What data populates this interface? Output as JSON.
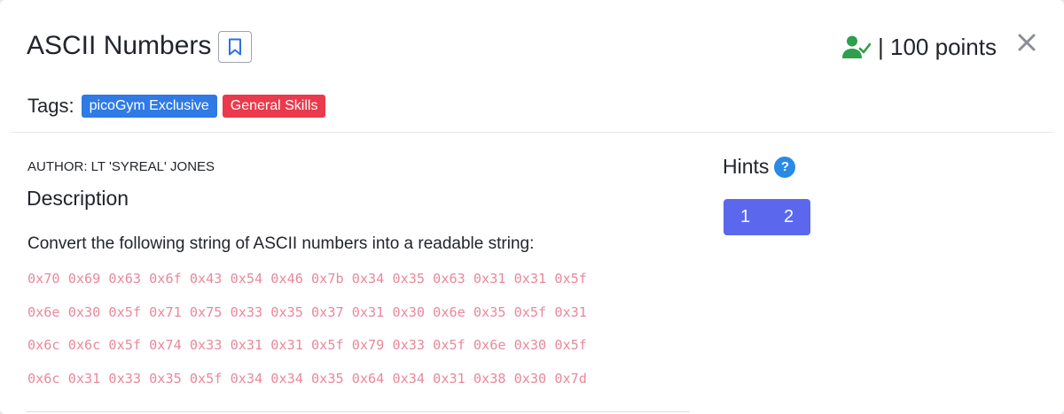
{
  "challenge": {
    "title": "ASCII Numbers",
    "points_text": "| 100 points",
    "tags_label": "Tags:",
    "tags": [
      "picoGym Exclusive",
      "General Skills"
    ],
    "author": "AUTHOR: LT 'SYREAL' JONES",
    "description_heading": "Description",
    "description_text": "Convert the following string of ASCII numbers into a readable string:",
    "code_lines": [
      "0x70 0x69 0x63 0x6f 0x43 0x54 0x46 0x7b 0x34 0x35 0x63 0x31 0x31 0x5f",
      "0x6e 0x30 0x5f 0x71 0x75 0x33 0x35 0x37 0x31 0x30 0x6e 0x35 0x5f 0x31",
      "0x6c 0x6c 0x5f 0x74 0x33 0x31 0x31 0x5f 0x79 0x33 0x5f 0x6e 0x30 0x5f",
      "0x6c 0x31 0x33 0x35 0x5f 0x34 0x34 0x35 0x64 0x34 0x31 0x38 0x30 0x7d"
    ]
  },
  "hints": {
    "heading": "Hints",
    "help_glyph": "?",
    "buttons": [
      "1",
      "2"
    ]
  },
  "icons": {
    "bookmark": "bookmark-icon",
    "solved": "user-check-icon",
    "close": "close-icon",
    "help": "question-circle-icon"
  },
  "colors": {
    "tag_blue": "#2f7ae5",
    "tag_red": "#ea3a4c",
    "hint_buttons": "#5b68ee",
    "solved_green": "#2e9f4c",
    "code_pink": "#e8899d",
    "help_blue": "#2a8ae6"
  }
}
